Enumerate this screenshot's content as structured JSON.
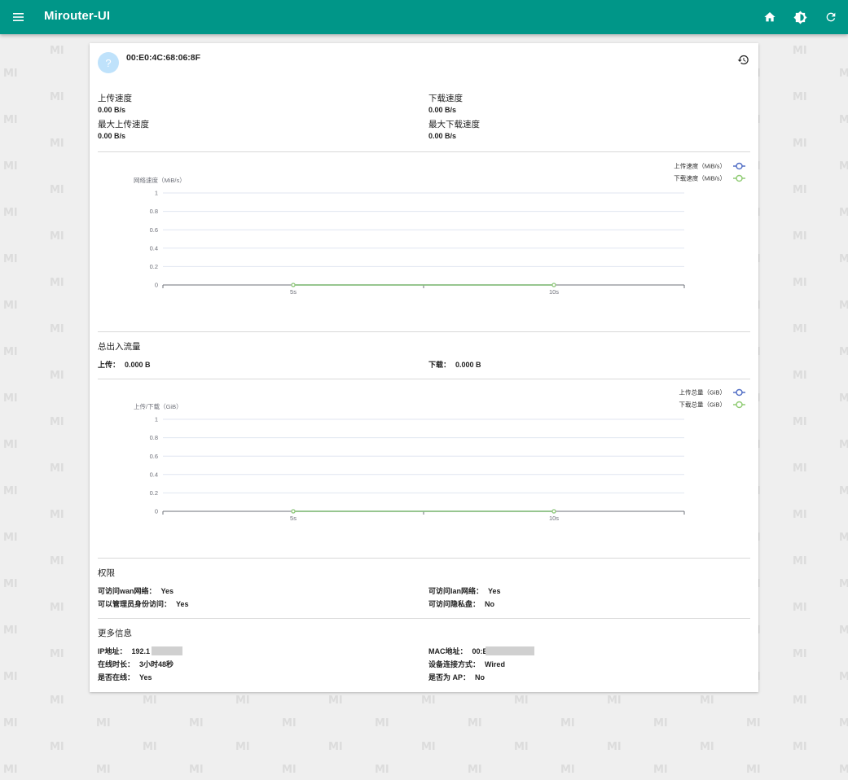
{
  "app": {
    "title": "Mirouter-UI",
    "watermark": "MI",
    "icons": [
      "menu-icon",
      "home-icon",
      "theme-icon",
      "refresh-icon"
    ],
    "colors": {
      "primary": "#009688",
      "upload": "#5470c6",
      "download": "#91cc75"
    }
  },
  "device": {
    "avatar_glyph": "?",
    "mac_title": "00:E0:4C:68:06:8F"
  },
  "speed": {
    "upload_label": "上传速度",
    "upload_value": "0.00 B/s",
    "max_upload_label": "最大上传速度",
    "max_upload_value": "0.00 B/s",
    "download_label": "下载速度",
    "download_value": "0.00 B/s",
    "max_download_label": "最大下载速度",
    "max_download_value": "0.00 B/s"
  },
  "traffic": {
    "title": "总出入流量",
    "upload_key": "上传：",
    "upload_value": "0.000 B",
    "download_key": "下载：",
    "download_value": "0.000 B"
  },
  "permissions": {
    "title": "权限",
    "wan_key": "可访问wan网络：",
    "wan_value": "Yes",
    "lan_key": "可访问lan网络：",
    "lan_value": "Yes",
    "admin_key": "可以管理员身份访问：",
    "admin_value": "Yes",
    "private_key": "可访问隐私盘：",
    "private_value": "No"
  },
  "more_info": {
    "title": "更多信息",
    "ip_key": "IP地址：",
    "ip_value": "192.1",
    "mac_key": "MAC地址：",
    "mac_value": "00:E",
    "online_time_key": "在线时长：",
    "online_time_value": "3小时48秒",
    "conn_type_key": "设备连接方式：",
    "conn_type_value": "Wired",
    "is_online_key": "是否在线：",
    "is_online_value": "Yes",
    "is_ap_key": "是否为 AP：",
    "is_ap_value": "No"
  },
  "chart_data": [
    {
      "type": "line",
      "ylabel": "网络速度（MiB/s）",
      "x": [
        "5s",
        "10s"
      ],
      "ylim": [
        0,
        1
      ],
      "yticks": [
        "1",
        "0.8",
        "0.6",
        "0.4",
        "0.2",
        "0"
      ],
      "grid": true,
      "legend": "top-right",
      "series": [
        {
          "name": "上传速度（MiB/s）",
          "values": [
            0,
            0
          ],
          "color": "#5470c6"
        },
        {
          "name": "下载速度（MiB/s）",
          "values": [
            0,
            0
          ],
          "color": "#91cc75"
        }
      ]
    },
    {
      "type": "line",
      "ylabel": "上传/下载（GiB）",
      "x": [
        "5s",
        "10s"
      ],
      "ylim": [
        0,
        1
      ],
      "yticks": [
        "1",
        "0.8",
        "0.6",
        "0.4",
        "0.2",
        "0"
      ],
      "grid": true,
      "legend": "top-right",
      "series": [
        {
          "name": "上传总量（GiB）",
          "values": [
            0,
            0
          ],
          "color": "#5470c6"
        },
        {
          "name": "下载总量（GiB）",
          "values": [
            0,
            0
          ],
          "color": "#91cc75"
        }
      ]
    }
  ]
}
